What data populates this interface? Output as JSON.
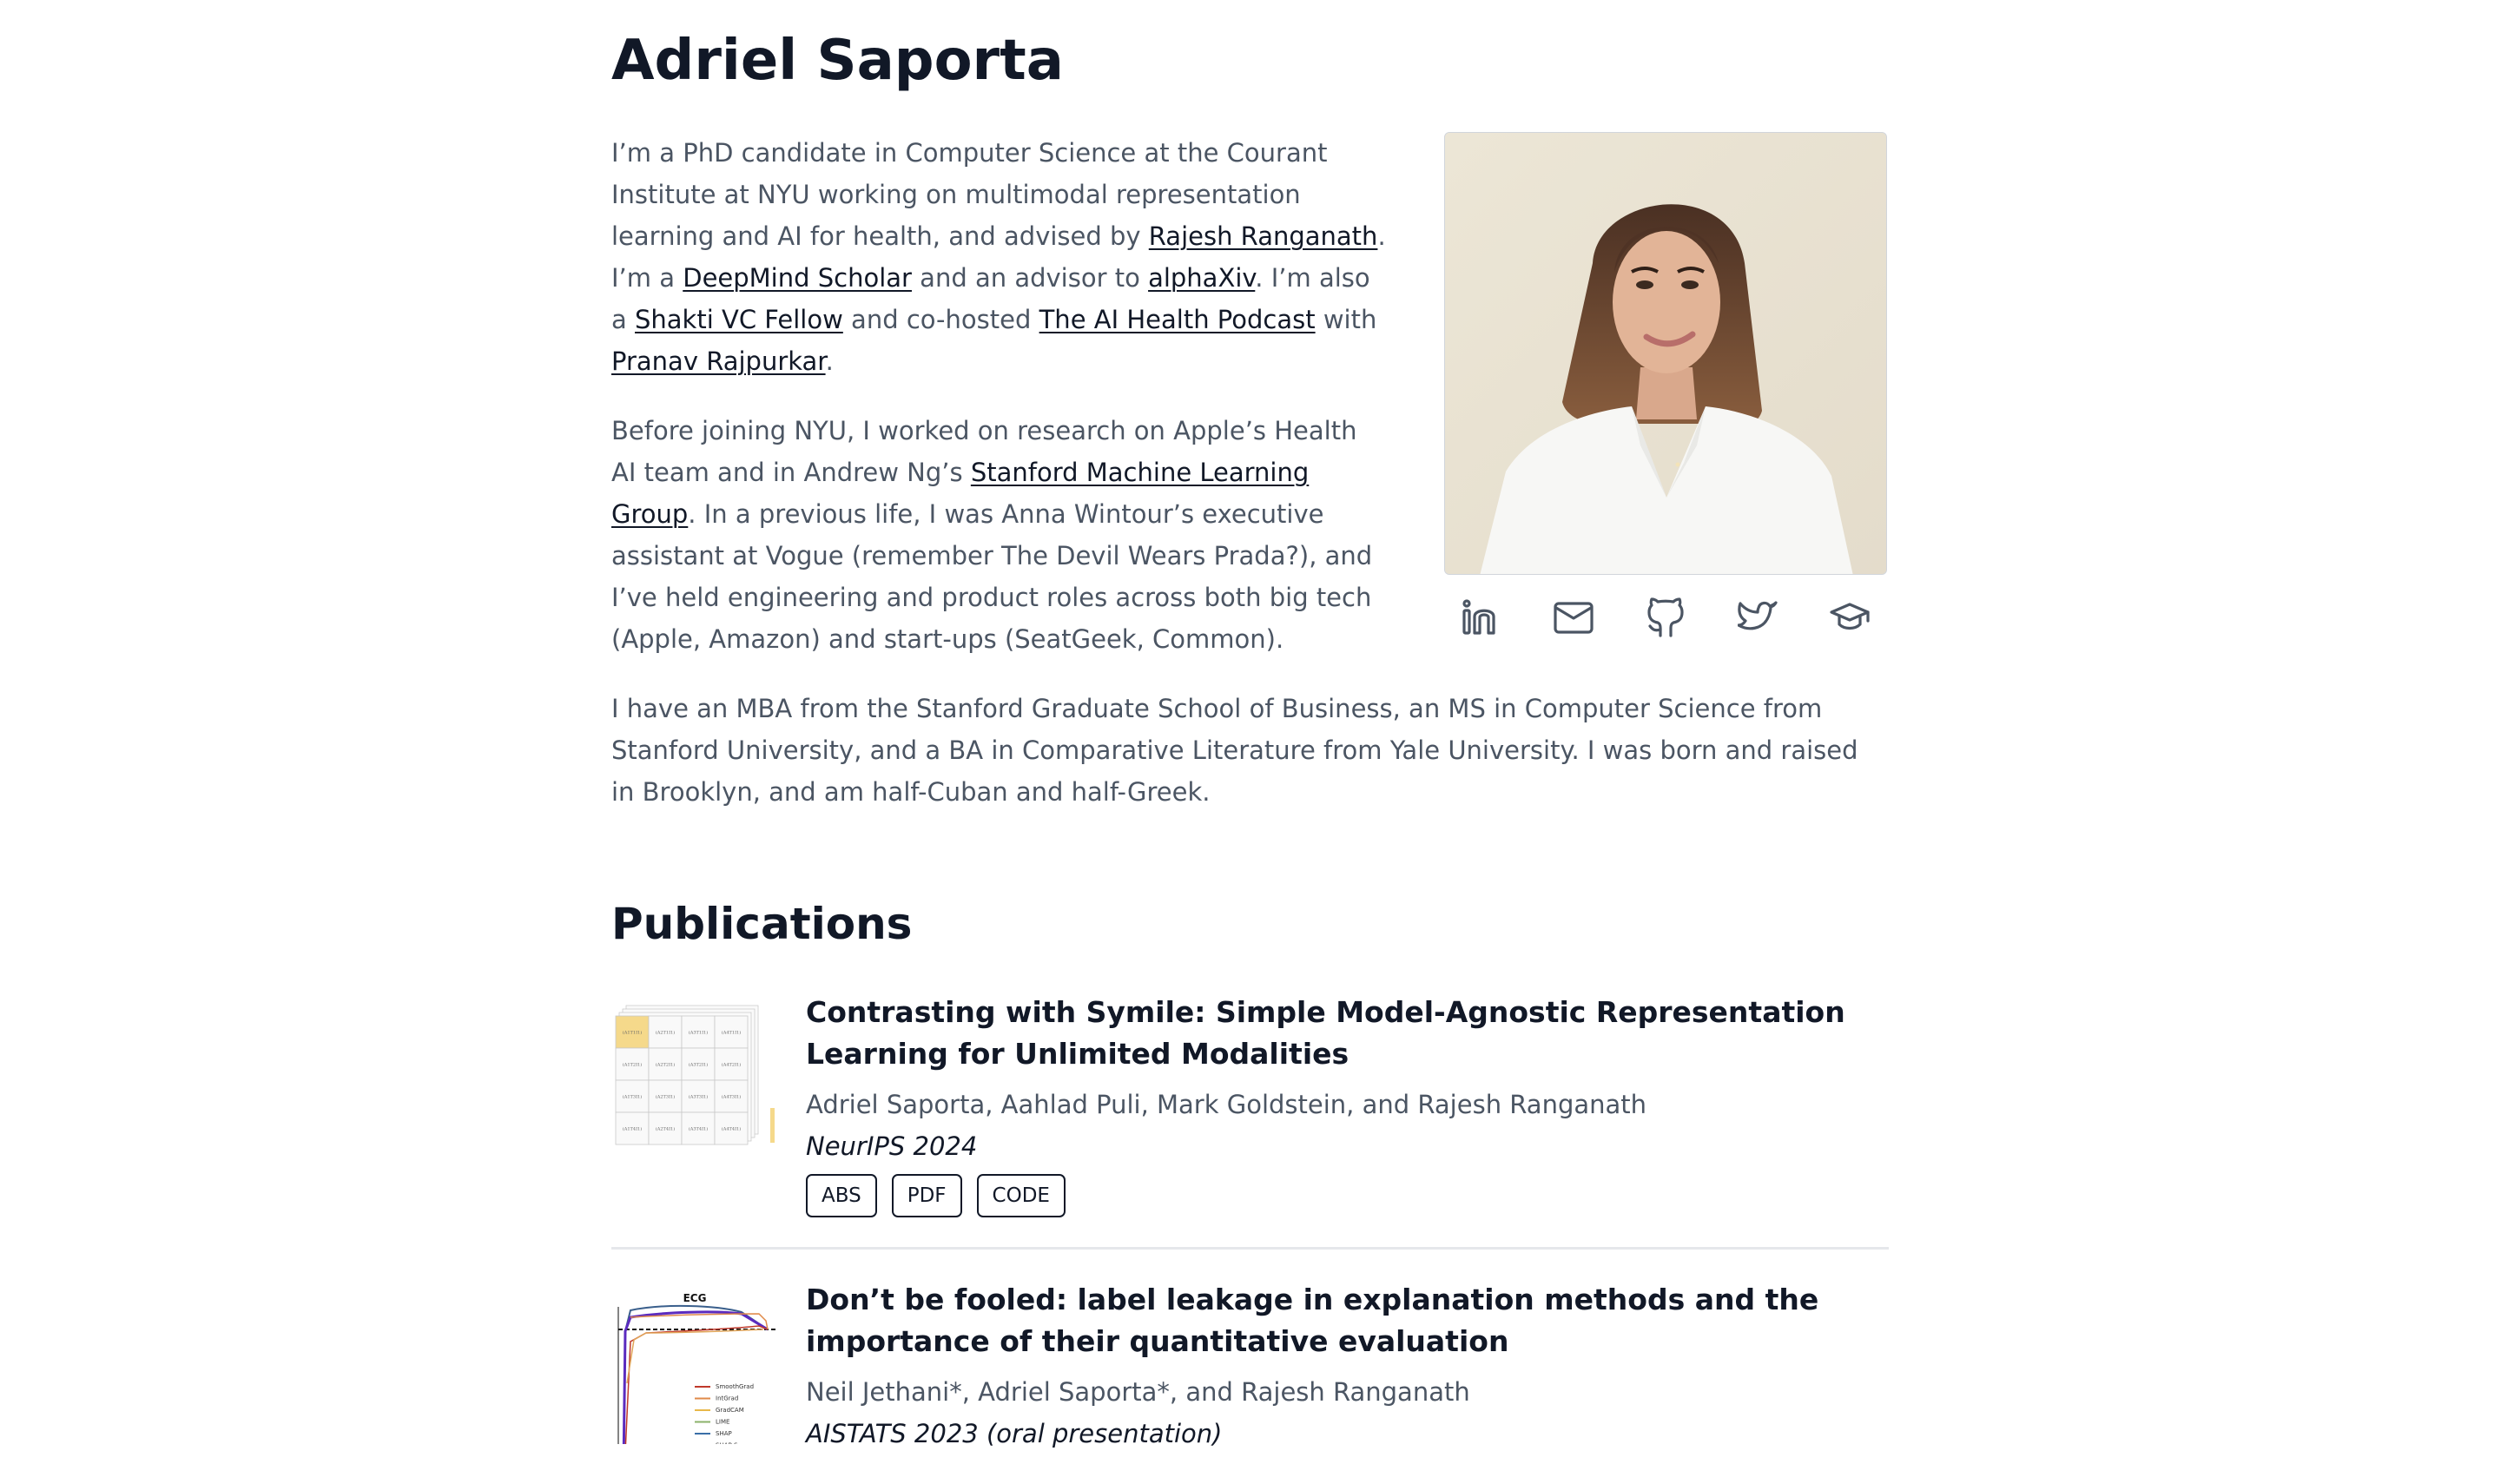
{
  "name": "Adriel Saporta",
  "about": {
    "photo_alt": "Portrait of Adriel Saporta",
    "paragraphs": [
      {
        "segments": [
          {
            "text": "I’m a PhD candidate in Computer Science at the Courant Institute at NYU working on multimodal representation learning and AI for health, and advised by "
          },
          {
            "text": "Rajesh Ranganath",
            "link": true
          },
          {
            "text": ". I’m a "
          },
          {
            "text": "DeepMind Scholar",
            "link": true
          },
          {
            "text": " and an advisor to "
          },
          {
            "text": "alphaXiv",
            "link": true
          },
          {
            "text": ". I’m also a "
          },
          {
            "text": "Shakti VC Fellow",
            "link": true
          },
          {
            "text": " and co-hosted "
          },
          {
            "text": "The AI Health Podcast",
            "link": true
          },
          {
            "text": " with "
          },
          {
            "text": "Pranav Rajpurkar",
            "link": true
          },
          {
            "text": "."
          }
        ]
      },
      {
        "segments": [
          {
            "text": "Before joining NYU, I worked on research on Apple’s Health AI team and in Andrew Ng’s "
          },
          {
            "text": "Stanford Machine Learning Group",
            "link": true
          },
          {
            "text": ". In a previous life, I was Anna Wintour’s executive assistant at Vogue (remember The Devil Wears Prada?), and I’ve held engineering and product roles across both big tech (Apple, Amazon) and start-ups (SeatGeek, Common)."
          }
        ]
      },
      {
        "segments": [
          {
            "text": "I have an MBA from the Stanford Graduate School of Business, an MS in Computer Science from Stanford University, and a BA in Comparative Literature from Yale University. I was born and raised in Brooklyn, and am half-Cuban and half-Greek."
          }
        ]
      }
    ],
    "socials": [
      {
        "name": "linkedin",
        "icon": "linkedin-icon"
      },
      {
        "name": "email",
        "icon": "mail-icon"
      },
      {
        "name": "github",
        "icon": "github-icon"
      },
      {
        "name": "twitter",
        "icon": "twitter-icon"
      },
      {
        "name": "google-scholar",
        "icon": "graduation-cap-icon"
      }
    ]
  },
  "publications": {
    "heading": "Publications",
    "items": [
      {
        "title": "Contrasting with Symile: Simple Model-Agnostic Representation Learning for Unlimited Modalities",
        "authors": "Adriel Saporta, Aahlad Puli, Mark Goldstein, and Rajesh Ranganath",
        "venue": "NeurIPS 2024",
        "buttons": [
          "ABS",
          "PDF",
          "CODE"
        ],
        "thumbnail": "symile-cube-figure"
      },
      {
        "title": "Don’t be fooled: label leakage in explanation methods and the importance of their quantitative evaluation",
        "authors": "Neil Jethani*, Adriel Saporta*, and Rajesh Ranganath",
        "venue": "AISTATS 2023 (oral presentation)",
        "buttons": [],
        "thumbnail": "ecg-plot-figure",
        "thumbnail_title": "ECG",
        "thumbnail_legend": [
          "SmoothGrad",
          "IntGrad",
          "GradCAM",
          "LIME",
          "SHAP",
          "SHAP-S"
        ]
      }
    ]
  },
  "colors": {
    "heading": "#111827",
    "body": "#4b5563",
    "divider": "#e5e7eb",
    "highlight": "#f5d98b"
  }
}
